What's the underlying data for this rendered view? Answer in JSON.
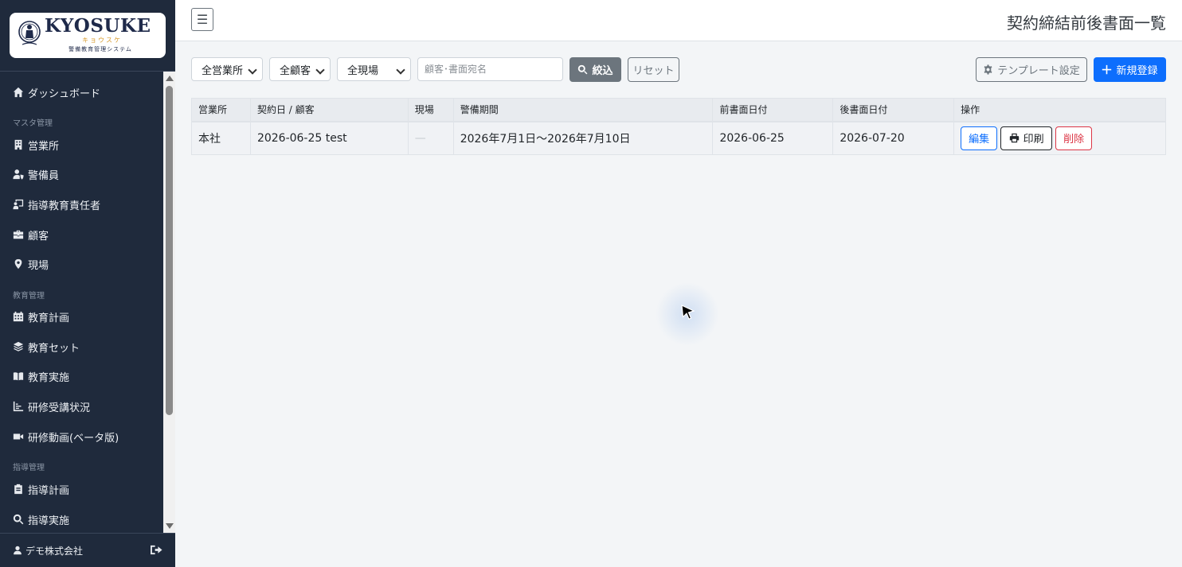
{
  "brand": {
    "name": "KYOSUKE",
    "kana": "キョウスケ",
    "tagline": "警備教育管理システム"
  },
  "sidebar": {
    "items": [
      {
        "label": "ダッシュボード",
        "icon": "home-icon"
      },
      {
        "section": "マスタ管理"
      },
      {
        "label": "営業所",
        "icon": "building-icon"
      },
      {
        "label": "警備員",
        "icon": "user-shield-icon"
      },
      {
        "label": "指導教育責任者",
        "icon": "chalkboard-teacher-icon"
      },
      {
        "label": "顧客",
        "icon": "briefcase-icon"
      },
      {
        "label": "現場",
        "icon": "map-pin-icon"
      },
      {
        "section": "教育管理"
      },
      {
        "label": "教育計画",
        "icon": "calendar-icon"
      },
      {
        "label": "教育セット",
        "icon": "layers-icon"
      },
      {
        "label": "教育実施",
        "icon": "book-open-icon"
      },
      {
        "label": "研修受講状況",
        "icon": "chart-icon"
      },
      {
        "label": "研修動画(ベータ版)",
        "icon": "video-icon"
      },
      {
        "section": "指導管理"
      },
      {
        "label": "指導計画",
        "icon": "clipboard-icon"
      },
      {
        "label": "指導実施",
        "icon": "search-icon"
      }
    ],
    "user": "デモ株式会社"
  },
  "header": {
    "title": "契約締結前後書面一覧"
  },
  "filters": {
    "office": "全営業所",
    "customer": "全顧客",
    "site": "全現場",
    "search_placeholder": "顧客･書面宛名",
    "filter_label": "絞込",
    "reset_label": "リセット",
    "template_label": "テンプレート設定",
    "new_label": "新規登録"
  },
  "table": {
    "headers": [
      "営業所",
      "契約日 / 顧客",
      "現場",
      "警備期間",
      "前書面日付",
      "後書面日付",
      "操作"
    ],
    "rows": [
      {
        "office": "本社",
        "contract": "2026-06-25 test",
        "site": "—",
        "period": "2026年7月1日～2026年7月10日",
        "pre_date": "2026-06-25",
        "post_date": "2026-07-20"
      }
    ],
    "actions": {
      "edit": "編集",
      "print": "印刷",
      "delete": "削除"
    }
  },
  "colors": {
    "sidebar_bg": "#1f2a3c",
    "primary": "#0d6efd",
    "danger": "#dc3545",
    "secondary": "#6c757d"
  }
}
